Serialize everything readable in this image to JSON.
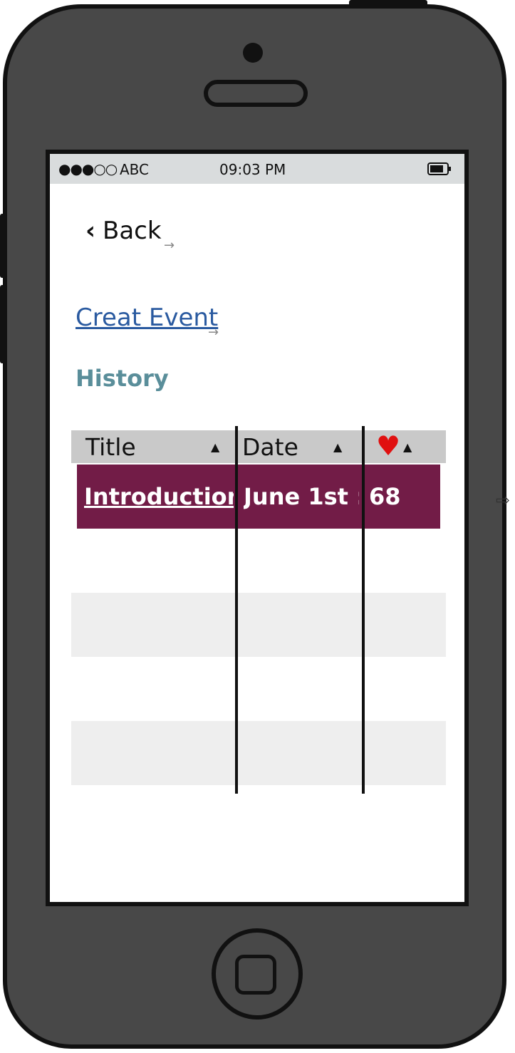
{
  "status_bar": {
    "signal": "●●●○○",
    "carrier": "ABC",
    "time": "09:03 PM"
  },
  "nav": {
    "back_label": "Back",
    "create_event_label": "Creat Event"
  },
  "section_title": "History",
  "table": {
    "columns": [
      "Title",
      "Date"
    ],
    "heart_symbol": "♥",
    "sort_symbol": "▲",
    "rows": [
      {
        "title": "Introduction",
        "date": "June 1st :",
        "likes": "68"
      }
    ]
  },
  "colors": {
    "selected_row": "#721c47",
    "link": "#2a5aa0",
    "heading": "#5a8e9a",
    "heart": "#e01010"
  }
}
